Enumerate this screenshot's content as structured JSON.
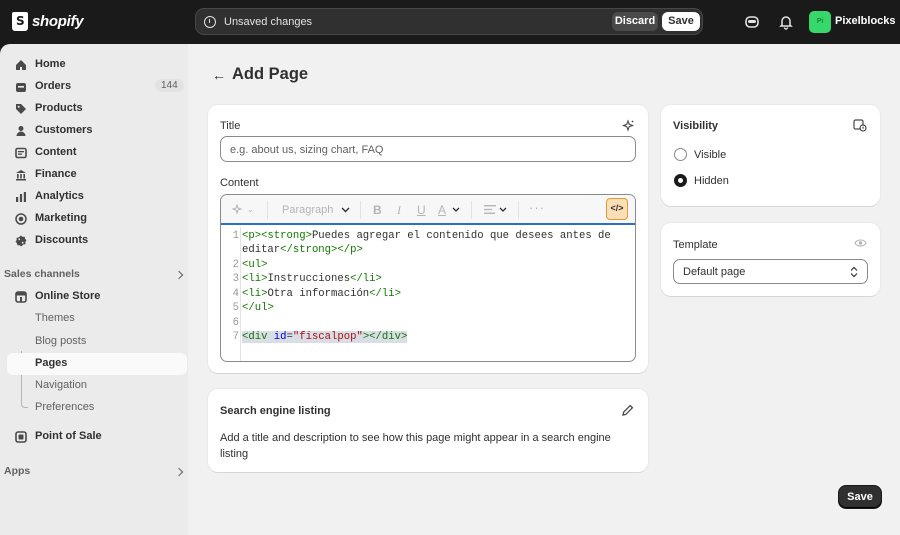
{
  "topbar": {
    "brand": "shopify",
    "unsaved_text": "Unsaved changes",
    "discard_label": "Discard",
    "save_label": "Save",
    "store_name": "Pixelblocks",
    "avatar_initials": "Pi"
  },
  "sidebar": {
    "items": [
      {
        "label": "Home",
        "icon": "home-icon"
      },
      {
        "label": "Orders",
        "icon": "orders-icon",
        "badge": "144"
      },
      {
        "label": "Products",
        "icon": "tag-icon"
      },
      {
        "label": "Customers",
        "icon": "person-icon"
      },
      {
        "label": "Content",
        "icon": "content-icon"
      },
      {
        "label": "Finance",
        "icon": "bank-icon"
      },
      {
        "label": "Analytics",
        "icon": "chart-icon"
      },
      {
        "label": "Marketing",
        "icon": "target-icon"
      },
      {
        "label": "Discounts",
        "icon": "discount-icon"
      }
    ],
    "sales_channels_heading": "Sales channels",
    "online_store": "Online Store",
    "sub_items": [
      "Themes",
      "Blog posts",
      "Pages",
      "Navigation",
      "Preferences"
    ],
    "point_of_sale": "Point of Sale",
    "apps_heading": "Apps"
  },
  "page": {
    "title": "Add Page",
    "title_label": "Title",
    "title_placeholder": "e.g. about us, sizing chart, FAQ",
    "content_label": "Content",
    "toolbar": {
      "paragraph": "Paragraph"
    },
    "code_lines": [
      {
        "n": "1",
        "text": "<p><strong>Puedes agregar el contenido que desees antes de"
      },
      {
        "n": "",
        "text": "editar</strong></p>"
      },
      {
        "n": "2",
        "text": "<ul>"
      },
      {
        "n": "3",
        "text": "<li>Instrucciones</li>"
      },
      {
        "n": "4",
        "text": "<li>Otra información</li>"
      },
      {
        "n": "5",
        "text": "</ul>"
      },
      {
        "n": "6",
        "text": ""
      },
      {
        "n": "7",
        "text": "<div id=\"fiscalpop\"></div>"
      }
    ],
    "seo_title": "Search engine listing",
    "seo_desc": "Add a title and description to see how this page might appear in a search engine listing",
    "visibility_title": "Visibility",
    "visibility_options": [
      "Visible",
      "Hidden"
    ],
    "visibility_selected": "Hidden",
    "template_title": "Template",
    "template_value": "Default page",
    "save_label": "Save"
  }
}
